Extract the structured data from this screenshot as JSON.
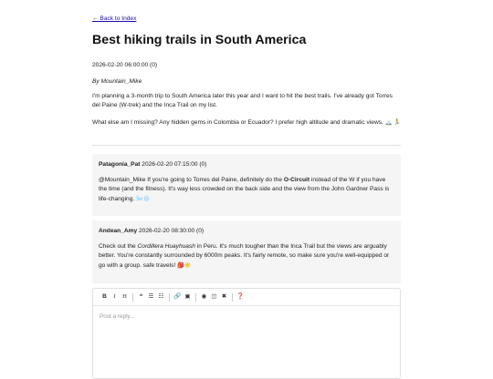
{
  "nav": {
    "back_label": "← Back to Index"
  },
  "post": {
    "title": "Best hiking trails in South America",
    "meta": "2026-02-20 06:00:00 (0)",
    "byline": "By Mountain_Mike",
    "paragraph1": "I'm planning a 3-month trip to South America later this year and I want to hit the best trails. I've already got Torres del Paine (W-trek) and the Inca Trail on my list.",
    "paragraph2_text": "What else am I missing? Any hidden gems in Colombia or Ecuador? I prefer high altitude and dramatic views.",
    "paragraph2_emoji": " 🏔️ 🏃"
  },
  "replies": [
    {
      "author": "Patagonia_Pat",
      "meta": "2026-02-20 07:15:00 (0)",
      "body_part1": "@Mountain_Mike If you're going to Torres del Paine, definitely do the ",
      "body_bold": "O-Circuit",
      "body_part2": " instead of the W if you have the time (and the fitness). It's way less crowded on the back side and the view from the John Gardner Pass is life-changing.",
      "emoji": " 🌬️❄️"
    },
    {
      "author": "Andean_Amy",
      "meta": "2026-02-20 08:30:00 (0)",
      "body_part1": "Check out the ",
      "body_italic": "Cordillera Huayhuash",
      "body_part2": " in Peru. It's much tougher than the Inca Trail but the views are arguably better. You're constantly surrounded by 6000m peaks. It's fairly remote, so make sure you're well-equipped or go with a group. safe travels!",
      "emoji": " 🎒☀️"
    }
  ],
  "editor": {
    "placeholder": "Post a reply...",
    "toolbar": {
      "bold": "B",
      "italic": "I",
      "heading": "H",
      "quote": "❝",
      "unordered_list": "☰",
      "ordered_list": "☷",
      "link": "🔗",
      "image": "▣",
      "preview": "◉",
      "side_by_side": "◫",
      "fullscreen": "✖",
      "guide": "❓"
    }
  }
}
